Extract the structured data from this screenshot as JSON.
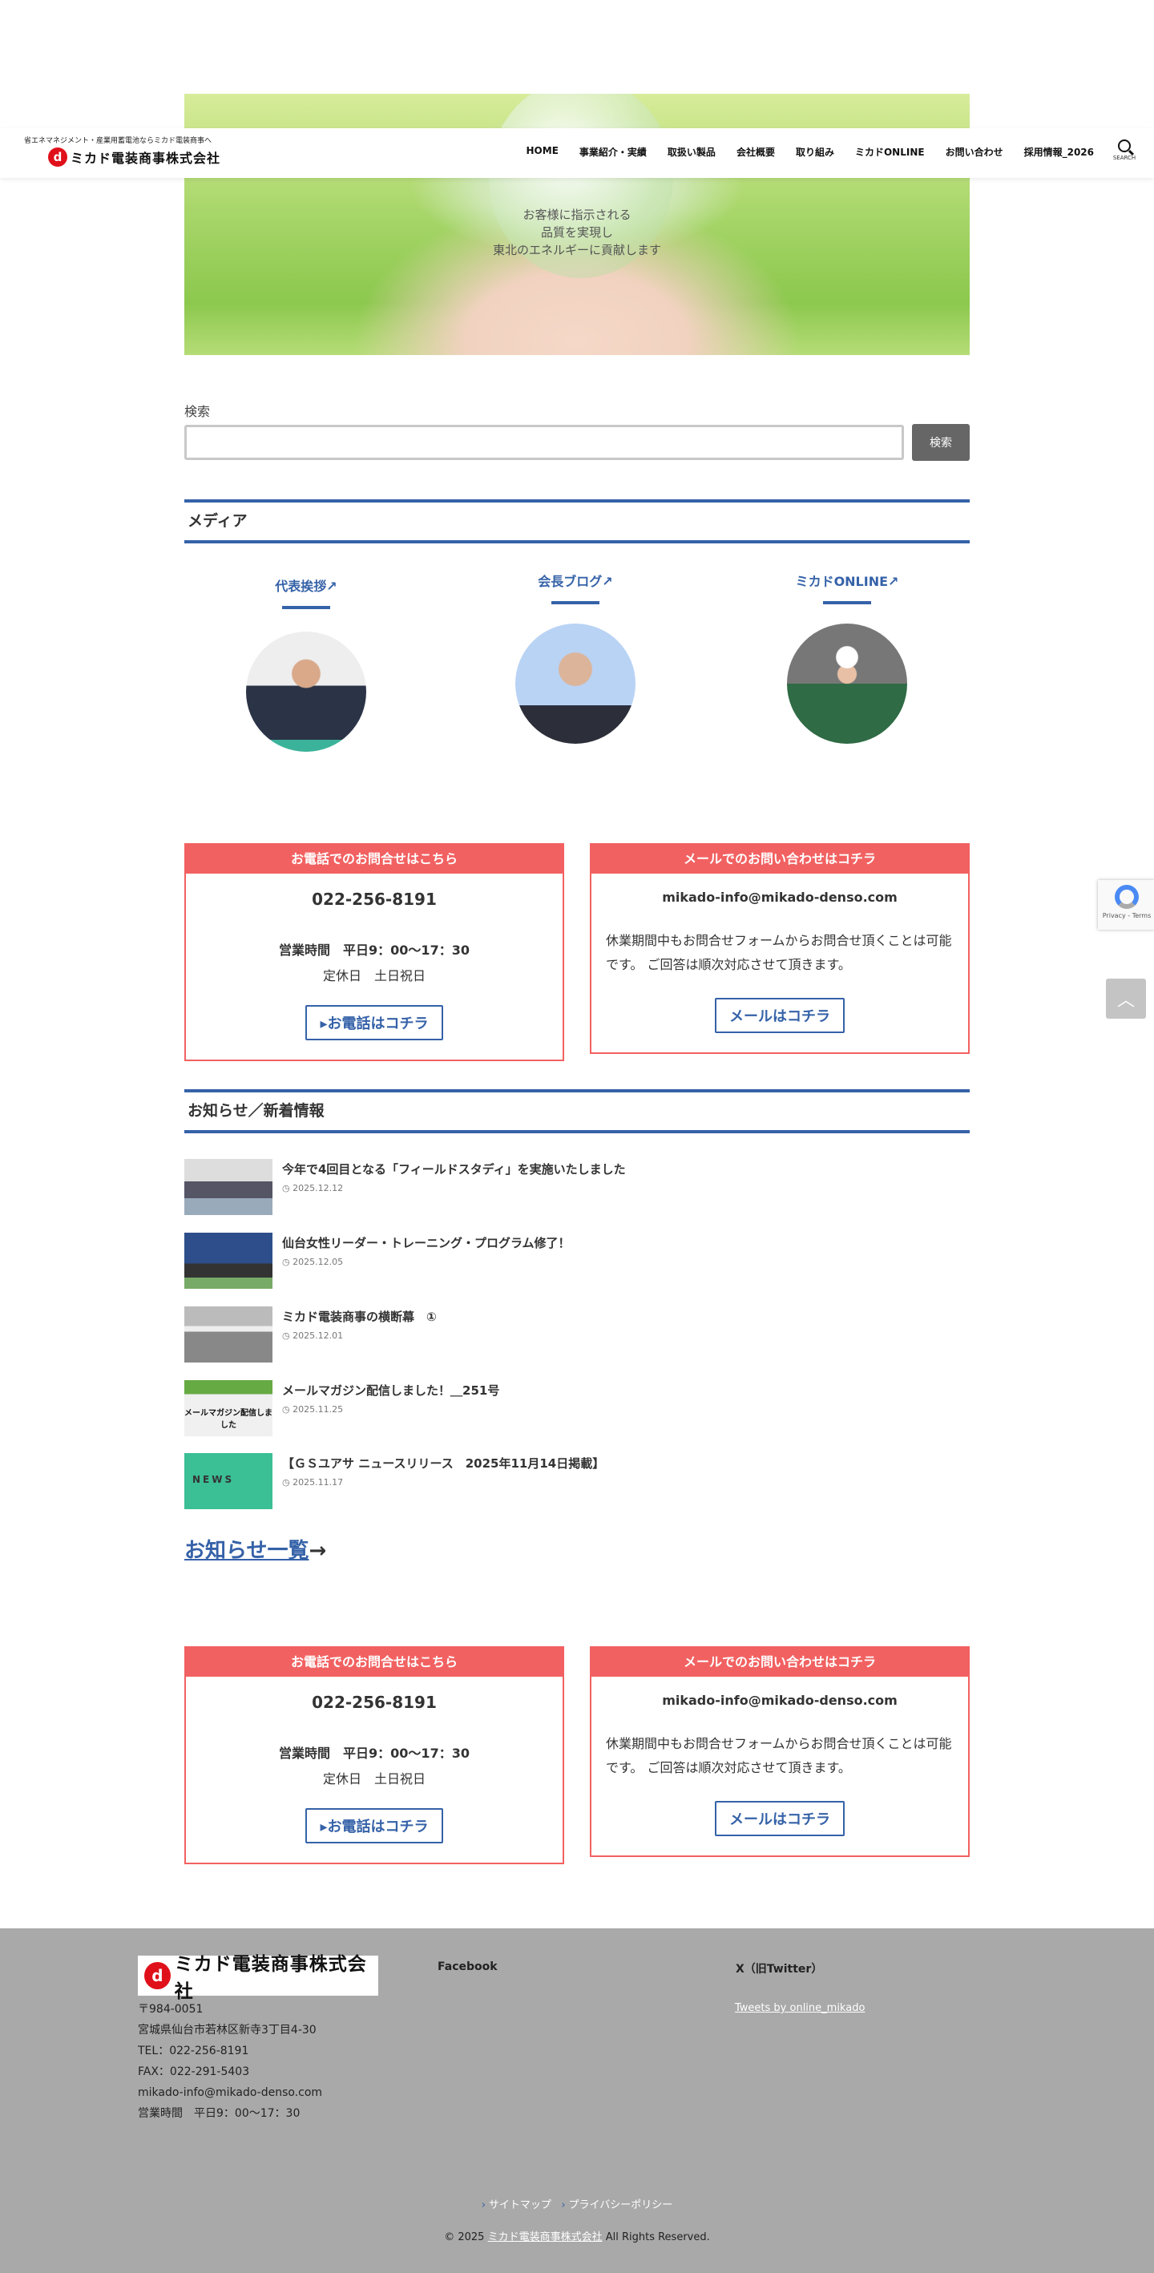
{
  "header": {
    "tagline": "省エネマネジメント・産業用蓄電池ならミカド電装商事へ",
    "logo_text": "ミカド電装商事株式会社",
    "logo_mark": "d",
    "nav": [
      "HOME",
      "事業紹介・実績",
      "取扱い製品",
      "会社概要",
      "取り組み",
      "ミカドONLINE",
      "お問い合わせ",
      "採用情報_2026"
    ],
    "search_label": "SEARCH"
  },
  "hero": {
    "lines": [
      "お客様に指示される",
      "品質を実現し",
      "東北のエネルギーに貢献します"
    ]
  },
  "search": {
    "label": "検索",
    "value": "",
    "placeholder": "",
    "button": "検索"
  },
  "media": {
    "heading": "メディア",
    "items": [
      {
        "label": "代表挨拶"
      },
      {
        "label": "会長ブログ"
      },
      {
        "label": "ミカドONLINE"
      }
    ],
    "ext_icon": "↗"
  },
  "contact": {
    "phone_header": "お電話でのお問合せはこちら",
    "phone": "022-256-8191",
    "hours": "営業時間　平日9：00〜17：30",
    "holiday": "定休日　土日祝日",
    "phone_button": "お電話はコチラ",
    "mail_header": "メールでのお問い合わせはコチラ",
    "email": "mikado-info@mikado-denso.com",
    "mail_msg": "休業期間中もお問合せフォームからお問合せ頂くことは可能です。 ご回答は順次対応させて頂きます。",
    "mail_button": "メールはコチラ"
  },
  "news": {
    "heading": "お知らせ／新着情報",
    "items": [
      {
        "title": "今年で4回目となる「フィールドスタディ」を実施いたしました",
        "date": "2025.12.12"
      },
      {
        "title": "仙台女性リーダー・トレーニング・プログラム修了！",
        "date": "2025.12.05"
      },
      {
        "title": "ミカド電装商事の横断幕　①",
        "date": "2025.12.01"
      },
      {
        "title": "メールマガジン配信しました！＿251号",
        "date": "2025.11.25",
        "thumb_text": "メールマガジン配信しました"
      },
      {
        "title": "【ＧＳユアサ ニュースリリース　2025年11月14日掲載】",
        "date": "2025.11.17",
        "thumb_text": "NEWS"
      }
    ],
    "more": "お知らせ一覧",
    "more_arrow": "→"
  },
  "footer": {
    "logo_text": "ミカド電装商事株式会社",
    "address": [
      "〒984-0051",
      "宮城県仙台市若林区新寺3丁目4-30",
      "TEL：022-256-8191",
      "FAX：022-291-5403",
      "mikado-info@mikado-denso.com",
      "営業時間　平日9：00〜17：30"
    ],
    "facebook": "Facebook",
    "x_heading": "X（旧Twitter）",
    "tweets_link": "Tweets by online_mikado",
    "links": [
      "サイトマップ",
      "プライバシーポリシー"
    ],
    "copyright_pre": "© 2025 ",
    "copyright_link": "ミカド電装商事株式会社",
    "copyright_post": " All Rights Reserved."
  },
  "recaptcha": {
    "text": "Privacy - Terms"
  },
  "colors": {
    "accent": "#3562a8",
    "contact_red": "#f26161",
    "footer_bg": "#a9a9a9"
  }
}
